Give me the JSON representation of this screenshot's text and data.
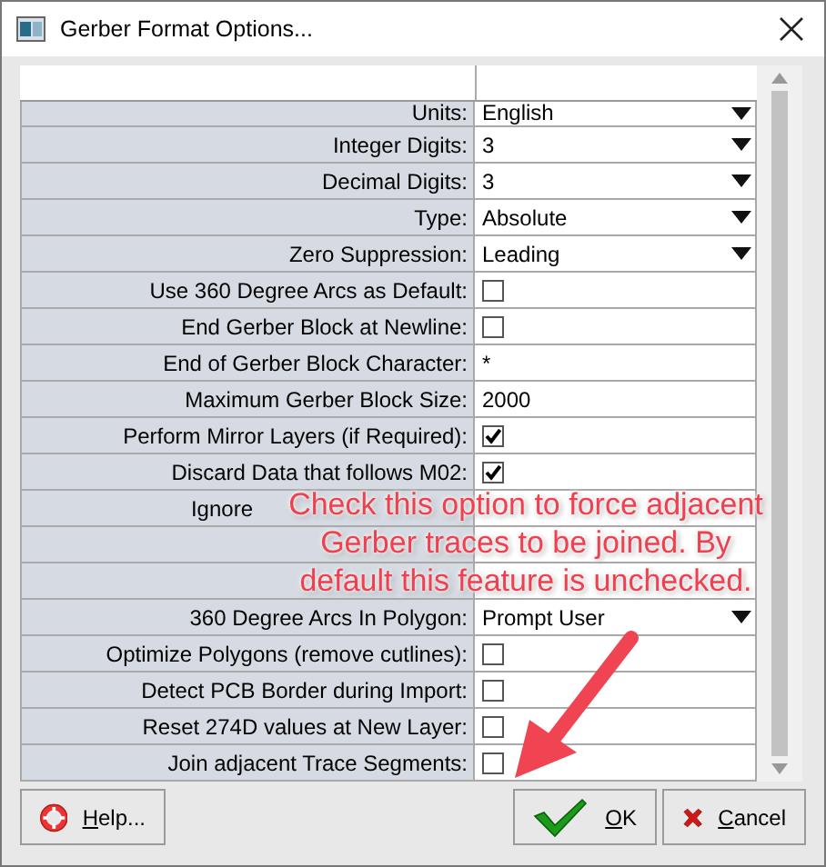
{
  "window": {
    "title": "Gerber Format Options..."
  },
  "rows": [
    {
      "label": "Units:",
      "kind": "dropdown",
      "value": "English"
    },
    {
      "label": "Integer Digits:",
      "kind": "dropdown",
      "value": "3"
    },
    {
      "label": "Decimal Digits:",
      "kind": "dropdown",
      "value": "3"
    },
    {
      "label": "Type:",
      "kind": "dropdown",
      "value": "Absolute"
    },
    {
      "label": "Zero Suppression:",
      "kind": "dropdown",
      "value": "Leading"
    },
    {
      "label": "Use 360 Degree Arcs as Default:",
      "kind": "checkbox",
      "checked": false
    },
    {
      "label": "End Gerber Block at Newline:",
      "kind": "checkbox",
      "checked": false
    },
    {
      "label": "End of Gerber Block Character:",
      "kind": "text",
      "value": "*"
    },
    {
      "label": "Maximum Gerber Block Size:",
      "kind": "text",
      "value": "2000"
    },
    {
      "label": "Perform Mirror Layers (if Required):",
      "kind": "checkbox",
      "checked": true
    },
    {
      "label": "Discard Data that follows M02:",
      "kind": "checkbox",
      "checked": true
    },
    {
      "label": "Ignore",
      "kind": "covered"
    },
    {
      "kind": "covered"
    },
    {
      "kind": "covered"
    },
    {
      "label": "360 Degree Arcs In Polygon:",
      "kind": "dropdown",
      "value": "Prompt User"
    },
    {
      "label": "Optimize Polygons (remove cutlines):",
      "kind": "checkbox",
      "checked": false
    },
    {
      "label": "Detect PCB Border during Import:",
      "kind": "checkbox",
      "checked": false
    },
    {
      "label": "Reset 274D values at New Layer:",
      "kind": "checkbox",
      "checked": false
    },
    {
      "label": "Join adjacent Trace Segments:",
      "kind": "checkbox",
      "checked": false
    }
  ],
  "buttons": [
    {
      "kind": "help",
      "label": "Help...",
      "mnemonic_first": true
    },
    {
      "kind": "ok",
      "label": "OK",
      "mnemonic_first": true
    },
    {
      "kind": "cancel",
      "label": "Cancel",
      "mnemonic_first": true
    }
  ],
  "callout": {
    "lines": [
      "Check this option to force adjacent",
      "Gerber traces to be joined. By",
      "default this feature is unchecked."
    ]
  }
}
